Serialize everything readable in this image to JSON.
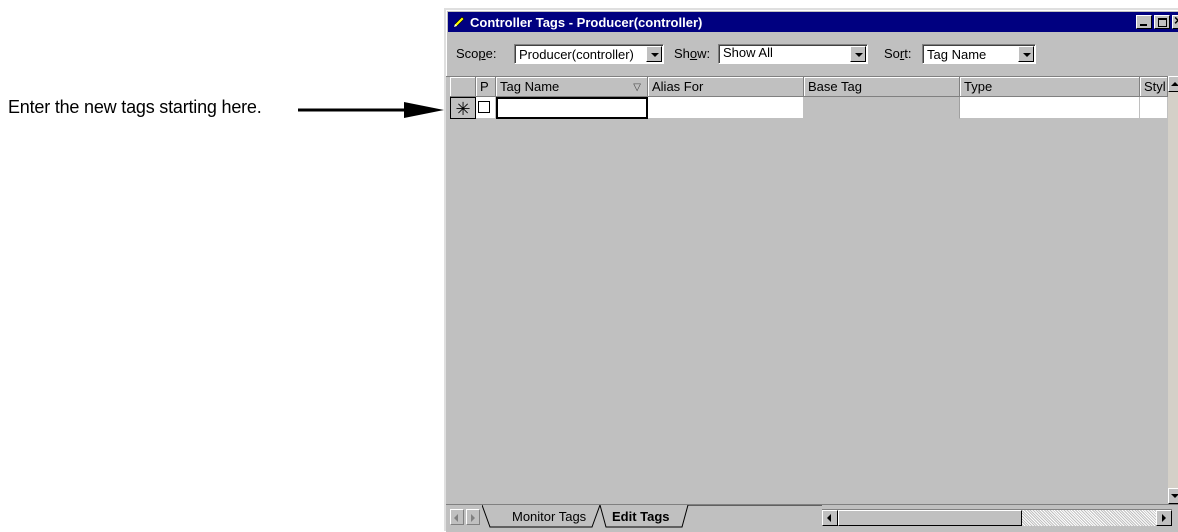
{
  "callout": {
    "text": "Enter the new tags starting here."
  },
  "window": {
    "title": "Controller Tags - Producer(controller)",
    "icon": "pencil-icon"
  },
  "toolbar": {
    "scope_label_pre": "Sco",
    "scope_label_u": "p",
    "scope_label_post": "e:",
    "scope_value": "Producer(controller)",
    "show_label_pre": "Sh",
    "show_label_u": "o",
    "show_label_post": "w:",
    "show_value": "Show All",
    "sort_label_pre": "So",
    "sort_label_u": "r",
    "sort_label_post": "t:",
    "sort_value": "Tag Name"
  },
  "grid": {
    "columns": [
      "P",
      "Tag Name",
      "Alias For",
      "Base Tag",
      "Type",
      "Styl"
    ],
    "sort_indicator": "▽",
    "new_row_marker": "✳"
  },
  "tabs": [
    {
      "label": "Monitor Tags",
      "active": false
    },
    {
      "label": "Edit Tags",
      "active": true
    }
  ],
  "colors": {
    "titlebar": "#000080",
    "face": "#c0c0c0"
  }
}
